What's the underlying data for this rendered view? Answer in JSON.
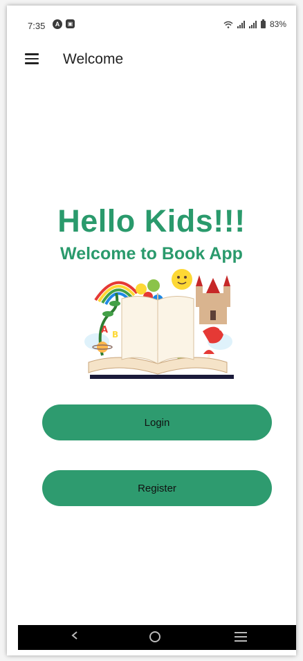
{
  "status_bar": {
    "time": "7:35",
    "battery": "83%",
    "icons": [
      "circle-a-icon",
      "image-notification-icon",
      "wifi-icon",
      "signal-icon",
      "signal-icon",
      "battery-icon"
    ]
  },
  "app_bar": {
    "title": "Welcome",
    "menu_icon": "hamburger-menu-icon"
  },
  "hero": {
    "heading": "Hello Kids!!!",
    "subheading": "Welcome to Book App",
    "image": "open-storybook-illustration"
  },
  "actions": {
    "login_label": "Login",
    "register_label": "Register"
  },
  "nav_bar": {
    "icons": [
      "back-icon",
      "home-icon",
      "recents-icon"
    ]
  },
  "colors": {
    "accent": "#2a9a6c",
    "button": "#2e9b6f",
    "nav_bar": "#000000"
  }
}
